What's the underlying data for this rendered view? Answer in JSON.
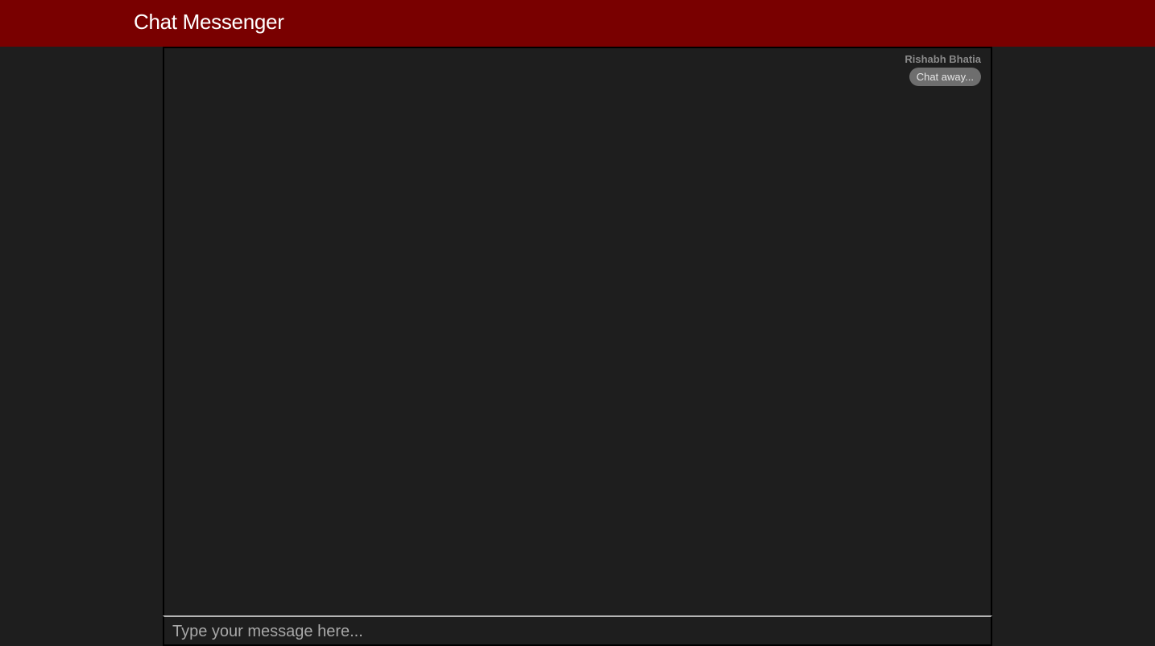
{
  "header": {
    "title": "Chat Messenger"
  },
  "chat": {
    "messages": [
      {
        "sender": "Rishabh Bhatia",
        "text": "Chat away..."
      }
    ]
  },
  "composer": {
    "placeholder": "Type your message here..."
  },
  "colors": {
    "header_bg": "#790000",
    "page_bg": "#1e1e1e",
    "bubble_bg": "#6e6e6e"
  }
}
